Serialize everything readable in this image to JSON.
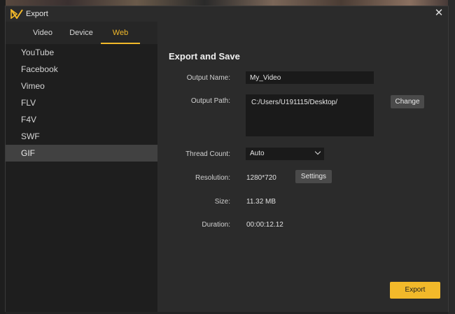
{
  "window": {
    "title": "Export",
    "close_glyph": "✕"
  },
  "tabs": [
    {
      "label": "Video"
    },
    {
      "label": "Device"
    },
    {
      "label": "Web"
    }
  ],
  "formats": [
    {
      "label": "YouTube"
    },
    {
      "label": "Facebook"
    },
    {
      "label": "Vimeo"
    },
    {
      "label": "FLV"
    },
    {
      "label": "F4V"
    },
    {
      "label": "SWF"
    },
    {
      "label": "GIF"
    }
  ],
  "export_settings": {
    "section_title": "Export and Save",
    "output_name_label": "Output Name:",
    "output_name_value": "My_Video",
    "output_path_label": "Output Path:",
    "output_path_value": "C:/Users/U191115/Desktop/",
    "change_label": "Change",
    "thread_count_label": "Thread Count:",
    "thread_count_value": "Auto",
    "resolution_label": "Resolution:",
    "resolution_value": "1280*720",
    "settings_label": "Settings",
    "size_label": "Size:",
    "size_value": "11.32 MB",
    "duration_label": "Duration:",
    "duration_value": "00:00:12.12",
    "export_label": "Export"
  },
  "colors": {
    "accent": "#f2b92a",
    "dialog_bg": "#2b2b2b",
    "list_bg": "#1e1e1e",
    "selected_bg": "#414141"
  },
  "icons": {
    "logo": "app-logo-icon",
    "close": "close-icon",
    "dropdown": "chevron-down-icon"
  }
}
